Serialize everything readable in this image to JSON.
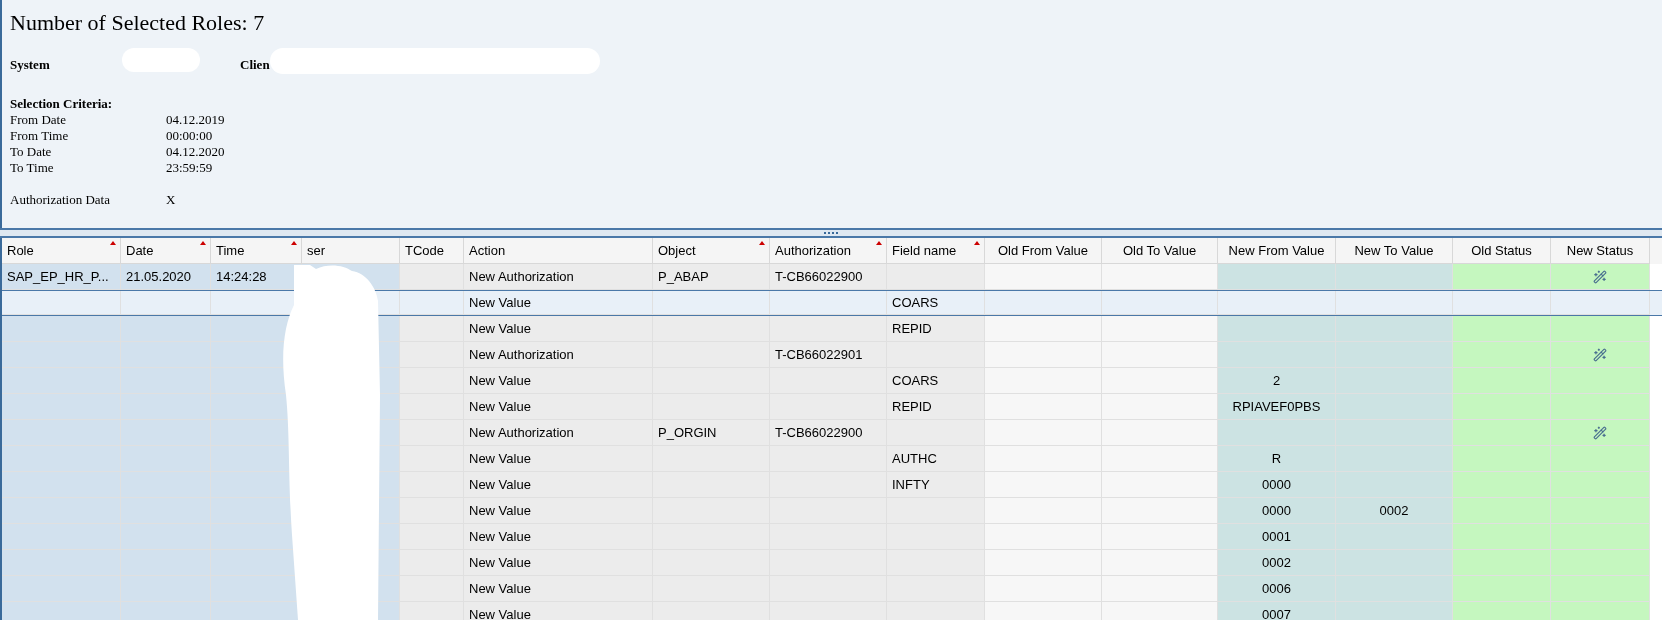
{
  "summary": {
    "title": "Number of Selected Roles: 7",
    "system_label": "System",
    "client_label": "Clien",
    "criteria_title": "Selection Criteria:",
    "criteria": [
      {
        "label": "From Date",
        "value": "04.12.2019"
      },
      {
        "label": "From Time",
        "value": "00:00:00"
      },
      {
        "label": "To Date",
        "value": "04.12.2020"
      },
      {
        "label": "To Time",
        "value": "23:59:59"
      }
    ],
    "auth_label": "Authorization Data",
    "auth_value": "X"
  },
  "table": {
    "columns": [
      {
        "label": "Role",
        "sorted": true
      },
      {
        "label": "Date",
        "sorted": true
      },
      {
        "label": "Time",
        "sorted": true
      },
      {
        "label": "ser",
        "sorted": false
      },
      {
        "label": "TCode",
        "sorted": false
      },
      {
        "label": "Action",
        "sorted": false
      },
      {
        "label": "Object",
        "sorted": true
      },
      {
        "label": "Authorization",
        "sorted": true
      },
      {
        "label": "Field name",
        "sorted": true
      },
      {
        "label": "Old From Value",
        "sorted": false
      },
      {
        "label": "Old To Value",
        "sorted": false
      },
      {
        "label": "New From Value",
        "sorted": false
      },
      {
        "label": "New To Value",
        "sorted": false
      },
      {
        "label": "Old Status",
        "sorted": false
      },
      {
        "label": "New Status",
        "sorted": false
      }
    ],
    "rows": [
      {
        "role": "SAP_EP_HR_P...",
        "date": "21.05.2020",
        "time": "14:24:28",
        "action": "New Authorization",
        "object": "P_ABAP",
        "authorization": "T-CB66022900",
        "field": "",
        "new_from": "",
        "new_to": "",
        "new_status_marked": true,
        "selected": false
      },
      {
        "role": "",
        "date": "",
        "time": "",
        "action": "New Value",
        "object": "",
        "authorization": "",
        "field": "COARS",
        "new_from": "",
        "new_to": "",
        "new_status_marked": false,
        "selected": true
      },
      {
        "role": "",
        "date": "",
        "time": "",
        "action": "New Value",
        "object": "",
        "authorization": "",
        "field": "REPID",
        "new_from": "",
        "new_to": "",
        "new_status_marked": false,
        "selected": false
      },
      {
        "role": "",
        "date": "",
        "time": "",
        "action": "New Authorization",
        "object": "",
        "authorization": "T-CB66022901",
        "field": "",
        "new_from": "",
        "new_to": "",
        "new_status_marked": true,
        "selected": false
      },
      {
        "role": "",
        "date": "",
        "time": "",
        "action": "New Value",
        "object": "",
        "authorization": "",
        "field": "COARS",
        "new_from": "2",
        "new_to": "",
        "new_status_marked": false,
        "selected": false
      },
      {
        "role": "",
        "date": "",
        "time": "",
        "action": "New Value",
        "object": "",
        "authorization": "",
        "field": "REPID",
        "new_from": "RPIAVEF0PBS",
        "new_to": "",
        "new_status_marked": false,
        "selected": false
      },
      {
        "role": "",
        "date": "",
        "time": "",
        "action": "New Authorization",
        "object": "P_ORGIN",
        "authorization": "T-CB66022900",
        "field": "",
        "new_from": "",
        "new_to": "",
        "new_status_marked": true,
        "selected": false
      },
      {
        "role": "",
        "date": "",
        "time": "",
        "action": "New Value",
        "object": "",
        "authorization": "",
        "field": "AUTHC",
        "new_from": "R",
        "new_to": "",
        "new_status_marked": false,
        "selected": false
      },
      {
        "role": "",
        "date": "",
        "time": "",
        "action": "New Value",
        "object": "",
        "authorization": "",
        "field": "INFTY",
        "new_from": "0000",
        "new_to": "",
        "new_status_marked": false,
        "selected": false
      },
      {
        "role": "",
        "date": "",
        "time": "",
        "action": "New Value",
        "object": "",
        "authorization": "",
        "field": "",
        "new_from": "0000",
        "new_to": "0002",
        "new_status_marked": false,
        "selected": false
      },
      {
        "role": "",
        "date": "",
        "time": "",
        "action": "New Value",
        "object": "",
        "authorization": "",
        "field": "",
        "new_from": "0001",
        "new_to": "",
        "new_status_marked": false,
        "selected": false
      },
      {
        "role": "",
        "date": "",
        "time": "",
        "action": "New Value",
        "object": "",
        "authorization": "",
        "field": "",
        "new_from": "0002",
        "new_to": "",
        "new_status_marked": false,
        "selected": false
      },
      {
        "role": "",
        "date": "",
        "time": "",
        "action": "New Value",
        "object": "",
        "authorization": "",
        "field": "",
        "new_from": "0006",
        "new_to": "",
        "new_status_marked": false,
        "selected": false
      },
      {
        "role": "",
        "date": "",
        "time": "",
        "action": "New Value",
        "object": "",
        "authorization": "",
        "field": "",
        "new_from": "0007",
        "new_to": "",
        "new_status_marked": false,
        "selected": false
      }
    ]
  }
}
